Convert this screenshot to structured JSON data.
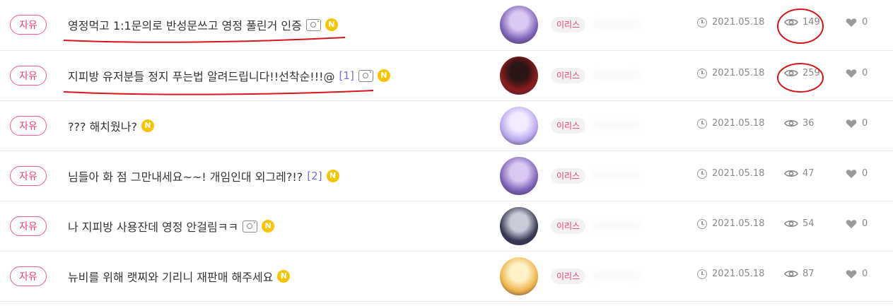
{
  "posts": [
    {
      "category": "자유",
      "title": "영정먹고 1:1문의로 반성문쓰고 영정 풀린거 인증",
      "comments": "",
      "has_image": true,
      "is_new": "N",
      "author_tag": "이리스",
      "date": "2021.05.18",
      "views": "149",
      "likes": "0",
      "avatar_colors": [
        "#7f63b8",
        "#d9c8f0"
      ]
    },
    {
      "category": "자유",
      "title": "지피방 유저분들 정지 푸는법 알려드립니다!!선착순!!!@",
      "comments": "[1]",
      "has_image": true,
      "is_new": "N",
      "author_tag": "이리스",
      "date": "2021.05.18",
      "views": "259",
      "likes": "0",
      "avatar_colors": [
        "#8d1b1b",
        "#2a1515"
      ]
    },
    {
      "category": "자유",
      "title": "??? 해치웠나?",
      "comments": "",
      "has_image": false,
      "is_new": "N",
      "author_tag": "이리스",
      "date": "2021.05.18",
      "views": "36",
      "likes": "0",
      "avatar_colors": [
        "#b9a7ee",
        "#f2eaff"
      ]
    },
    {
      "category": "자유",
      "title": "님들아 화 점 그만내세요~~! 개임인대 외그레?!?",
      "comments": "[2]",
      "has_image": false,
      "is_new": "N",
      "author_tag": "이리스",
      "date": "2021.05.18",
      "views": "47",
      "likes": "0",
      "avatar_colors": [
        "#7f63b8",
        "#d9c8f0"
      ]
    },
    {
      "category": "자유",
      "title": "나 지피방 사용잔데 영정 안걸림ㅋㅋ",
      "comments": "",
      "has_image": true,
      "is_new": "N",
      "author_tag": "이리스",
      "date": "2021.05.18",
      "views": "54",
      "likes": "0",
      "avatar_colors": [
        "#3a3a55",
        "#c9ccd8"
      ]
    },
    {
      "category": "자유",
      "title": "뉴비를 위해 랫찌와 기리니 재판매 해주세요",
      "comments": "",
      "has_image": false,
      "is_new": "N",
      "author_tag": "이리스",
      "date": "2021.05.18",
      "views": "87",
      "likes": "0",
      "avatar_colors": [
        "#f0b44a",
        "#fff1c8"
      ]
    }
  ],
  "colors": {
    "accent": "#e8417a",
    "new_badge": "#f6c400",
    "annotation": "#d9141b"
  }
}
